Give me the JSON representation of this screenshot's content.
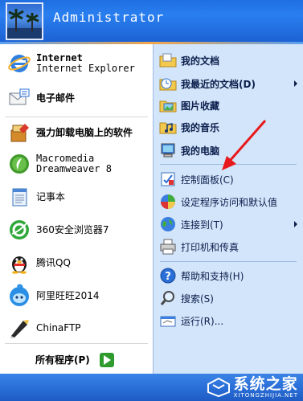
{
  "header": {
    "user_name": "Administrator"
  },
  "left": {
    "pinned": [
      {
        "title": "Internet",
        "subtitle": "Internet Explorer",
        "icon": "internet-explorer-icon"
      },
      {
        "title": "电子邮件",
        "icon": "email-icon"
      }
    ],
    "recent": [
      {
        "label": "强力卸载电脑上的软件",
        "icon": "uninstaller-icon"
      },
      {
        "label": "Macromedia Dreamweaver 8",
        "icon": "dreamweaver-icon"
      },
      {
        "label": "记事本",
        "icon": "notepad-icon"
      },
      {
        "label": "360安全浏览器7",
        "icon": "360-browser-icon"
      },
      {
        "label": "腾讯QQ",
        "icon": "qq-icon"
      },
      {
        "label": "阿里旺旺2014",
        "icon": "aliwangwang-icon"
      },
      {
        "label": "ChinaFTP",
        "icon": "chinaftp-icon"
      }
    ],
    "all_programs": "所有程序(P)"
  },
  "right": {
    "items": [
      {
        "label": "我的文档",
        "icon": "my-documents-icon"
      },
      {
        "label": "我最近的文档(D)",
        "icon": "recent-documents-icon"
      },
      {
        "label": "图片收藏",
        "icon": "my-pictures-icon"
      },
      {
        "label": "我的音乐",
        "icon": "my-music-icon"
      },
      {
        "label": "我的电脑",
        "icon": "my-computer-icon"
      },
      {
        "label": "控制面板(C)",
        "icon": "control-panel-icon"
      },
      {
        "label": "设定程序访问和默认值",
        "icon": "set-program-access-icon"
      },
      {
        "label": "连接到(T)",
        "icon": "connect-to-icon"
      },
      {
        "label": "打印机和传真",
        "icon": "printers-faxes-icon"
      },
      {
        "label": "帮助和支持(H)",
        "icon": "help-support-icon"
      },
      {
        "label": "搜索(S)",
        "icon": "search-icon"
      },
      {
        "label": "运行(R)...",
        "icon": "run-icon"
      }
    ]
  },
  "watermark": {
    "text": "系统之家",
    "url": "XITONGZHIJIA.NET"
  },
  "colors": {
    "header": "#2a7ff0",
    "right_panel": "#d3e5fa",
    "footer": "#2a6fd8",
    "annotation_arrow": "#e8191c"
  }
}
